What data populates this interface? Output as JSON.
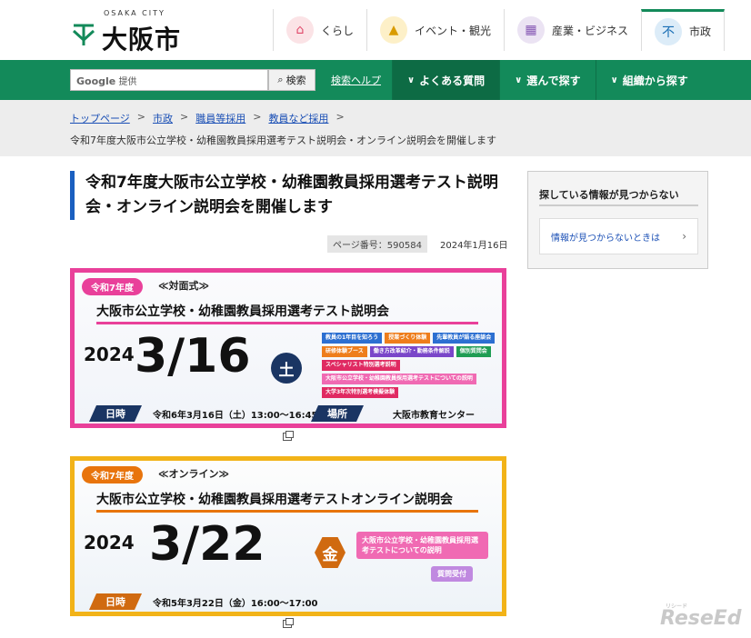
{
  "header": {
    "logo_sub": "OSAKA CITY",
    "logo_main": "大阪市",
    "categories": [
      {
        "label": "くらし",
        "icon": "house-icon"
      },
      {
        "label": "イベント・観光",
        "icon": "castle-icon"
      },
      {
        "label": "産業・ビジネス",
        "icon": "building-icon"
      },
      {
        "label": "市政",
        "icon": "city-emblem-icon"
      }
    ]
  },
  "search": {
    "google": "Google",
    "provided": "提供",
    "button": "検索",
    "help": "検索ヘルプ"
  },
  "gnav": [
    "よくある質問",
    "選んで探す",
    "組織から探す"
  ],
  "breadcrumb": {
    "items": [
      "トップページ",
      "市政",
      "職員等採用",
      "教員など採用"
    ],
    "current": "令和7年度大阪市公立学校・幼稚園教員採用選考テスト説明会・オンライン説明会を開催します"
  },
  "article": {
    "title": "令和7年度大阪市公立学校・幼稚園教員採用選考テスト説明会・オンライン説明会を開催します",
    "page_no": "ページ番号：590584",
    "date": "2024年1月16日"
  },
  "banner1": {
    "pill": "令和7年度",
    "mode": "≪対面式≫",
    "title": "大阪市公立学校・幼稚園教員採用選考テスト説明会",
    "year": "2024",
    "date": "3/16",
    "dow": "土",
    "tags": [
      {
        "text": "教員の1年目を知ろう",
        "color": "blue"
      },
      {
        "text": "授業づくり体験",
        "color": "orange"
      },
      {
        "text": "先輩教員が語る座談会",
        "color": "blue"
      },
      {
        "text": "研修体験ブース",
        "color": "orange"
      },
      {
        "text": "働き方改革紹介・勤務条件解説",
        "color": "purple"
      },
      {
        "text": "個別質問会",
        "color": "green"
      },
      {
        "text": "スペシャリスト特別選考説明",
        "color": "red"
      },
      {
        "text": "大阪市公立学校・幼稚園教員採用選考テストについての説明",
        "color": "pink"
      },
      {
        "text": "大学3年次特別選考模擬体験",
        "color": "red"
      }
    ],
    "when_label": "日時",
    "when_value": "令和6年3月16日（土）13:00～16:45",
    "where_label": "場所",
    "where_value": "大阪市教育センター"
  },
  "banner2": {
    "pill": "令和7年度",
    "mode": "≪オンライン≫",
    "title": "大阪市公立学校・幼稚園教員採用選考テストオンライン説明会",
    "year": "2024",
    "date": "3/22",
    "dow": "金",
    "info": "大阪市公立学校・幼稚園教員採用選考テストについての説明",
    "qa": "質問受付",
    "when_label": "日時",
    "when_value": "令和5年3月22日（金）16:00～17:00"
  },
  "sidebar": {
    "heading": "探している情報が見つからない",
    "link": "情報が見つからないときは"
  },
  "watermark": {
    "main": "ReseEd",
    "sub": "リシード"
  },
  "colors": {
    "green": "#138a5a",
    "pink": "#e9409a",
    "yellow": "#f2b318",
    "navy": "#1a3563",
    "orange": "#d06a10"
  }
}
